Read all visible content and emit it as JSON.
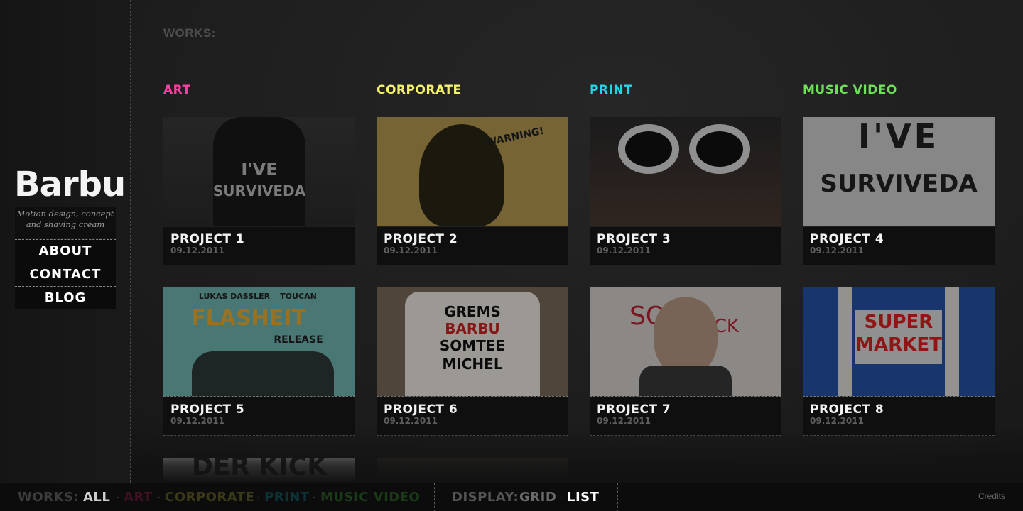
{
  "brand": {
    "logo": "Barbu",
    "tagline_line1": "Motion design, concept",
    "tagline_line2": "and shaving cream"
  },
  "nav": [
    "ABOUT",
    "CONTACT",
    "BLOG"
  ],
  "works_title": "WORKS:",
  "categories": [
    {
      "label": "ART",
      "color": "#ff3ea5"
    },
    {
      "label": "CORPORATE",
      "color": "#f4f06b"
    },
    {
      "label": "PRINT",
      "color": "#21d6e8"
    },
    {
      "label": "MUSIC VIDEO",
      "color": "#6ee05a"
    }
  ],
  "projects": [
    {
      "title": "PROJECT 1",
      "date": "09.12.2011"
    },
    {
      "title": "PROJECT 2",
      "date": "09.12.2011"
    },
    {
      "title": "PROJECT 3",
      "date": "09.12.2011"
    },
    {
      "title": "PROJECT 4",
      "date": "09.12.2011"
    },
    {
      "title": "PROJECT 5",
      "date": "09.12.2011"
    },
    {
      "title": "PROJECT 6",
      "date": "09.12.2011"
    },
    {
      "title": "PROJECT 7",
      "date": "09.12.2011"
    },
    {
      "title": "PROJECT 8",
      "date": "09.12.2011"
    }
  ],
  "footer": {
    "works_label": "WORKS:",
    "filters": [
      "ALL",
      "ART",
      "CORPORATE",
      "PRINT",
      "MUSIC VIDEO"
    ],
    "display_label": "DISPLAY:",
    "display_options": [
      "GRID",
      "LIST"
    ],
    "credits": "Credits"
  }
}
